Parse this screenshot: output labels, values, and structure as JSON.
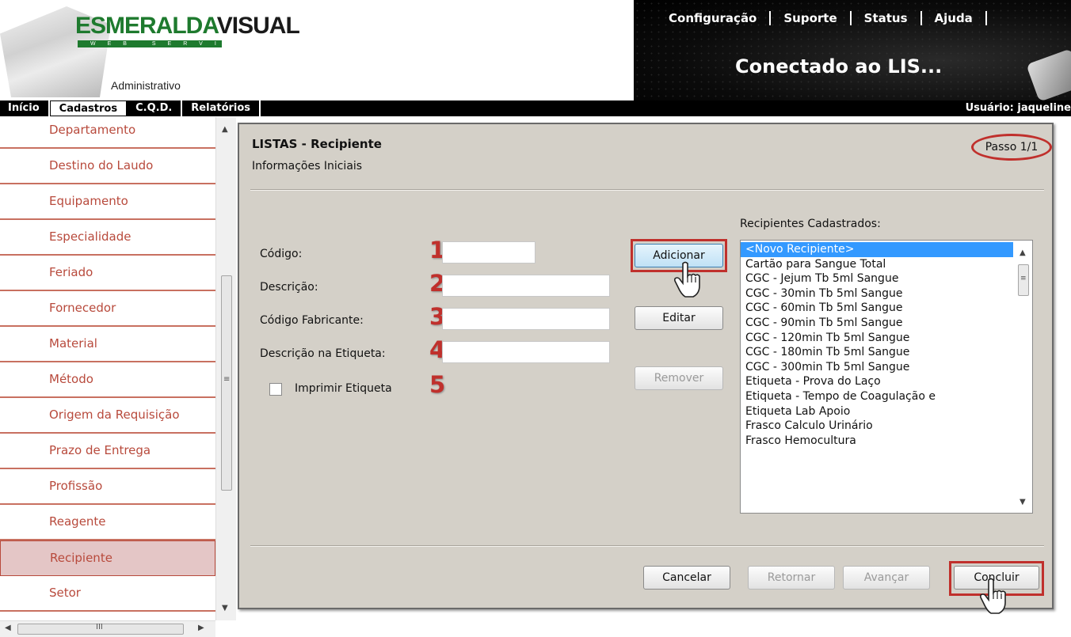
{
  "header": {
    "logo_part1": "ESMERALDA",
    "logo_part2": "VISUAL",
    "logo_tagline": "WEB SERVICE",
    "module_label": "Administrativo",
    "top_links": [
      "Configuração",
      "Suporte",
      "Status",
      "Ajuda"
    ],
    "connection_status": "Conectado ao LIS..."
  },
  "nav": {
    "items": [
      "Início",
      "Cadastros",
      "C.Q.D.",
      "Relatórios"
    ],
    "active": "Cadastros",
    "user": "Usuário: jaqueline"
  },
  "sidebar": {
    "items": [
      "Departamento",
      "Destino do Laudo",
      "Equipamento",
      "Especialidade",
      "Feriado",
      "Fornecedor",
      "Material",
      "Método",
      "Origem da Requisição",
      "Prazo de Entrega",
      "Profissão",
      "Reagente",
      "Recipiente",
      "Setor"
    ],
    "selected": "Recipiente"
  },
  "panel": {
    "title": "LISTAS - Recipiente",
    "subtitle": "Informações Iniciais",
    "step": "Passo 1/1",
    "fields": {
      "codigo": {
        "label": "Código:",
        "value": ""
      },
      "descricao": {
        "label": "Descrição:",
        "value": ""
      },
      "codigo_fabricante": {
        "label": "Código Fabricante:",
        "value": ""
      },
      "descricao_etiqueta": {
        "label": "Descrição na Etiqueta:",
        "value": ""
      },
      "imprimir_etiqueta": {
        "label": "Imprimir Etiqueta",
        "checked": false
      }
    },
    "markers": [
      "1",
      "2",
      "3",
      "4",
      "5"
    ],
    "buttons": {
      "adicionar": "Adicionar",
      "editar": "Editar",
      "remover": "Remover",
      "cancelar": "Cancelar",
      "retornar": "Retornar",
      "avancar": "Avançar",
      "concluir": "Concluir"
    },
    "list_label": "Recipientes Cadastrados:",
    "list_items": [
      "<Novo Recipiente>",
      "Cartão para Sangue Total",
      "CGC -   Jejum Tb 5ml Sangue",
      "CGC -  30min  Tb 5ml Sangue",
      "CGC -  60min  Tb 5ml Sangue",
      "CGC -  90min  Tb 5ml Sangue",
      "CGC - 120min  Tb 5ml Sangue",
      "CGC - 180min  Tb 5ml Sangue",
      "CGC - 300min  Tb 5ml Sangue",
      "Etiqueta - Prova do Laço",
      "Etiqueta - Tempo de Coagulação e",
      "Etiqueta Lab Apoio",
      "Frasco Calculo Urinário",
      "Frasco Hemocultura"
    ],
    "list_selected_index": 0
  },
  "colors": {
    "accent_red": "#c0302c",
    "sidebar_text": "#b84a3c",
    "panel_bg": "#d4d0c8",
    "selection_blue": "#3399ff",
    "logo_green": "#1e7a2e"
  }
}
